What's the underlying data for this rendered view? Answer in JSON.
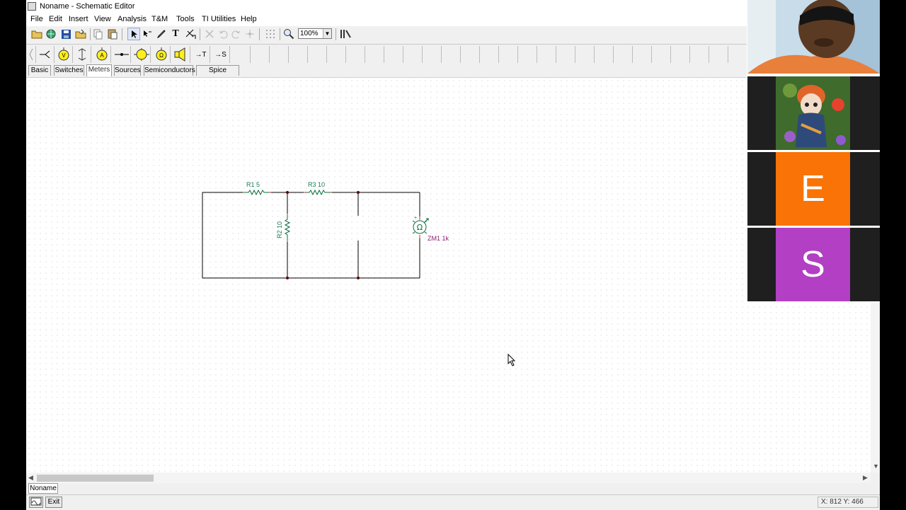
{
  "window": {
    "title": "Noname - Schematic Editor"
  },
  "menu": [
    "File",
    "Edit",
    "Insert",
    "View",
    "Analysis",
    "T&M",
    "Tools",
    "TI Utilities",
    "Help"
  ],
  "toolbar": {
    "zoom_value": "100%"
  },
  "part_tabs": [
    "Basic",
    "Switches",
    "Meters",
    "Sources",
    "Semiconductors",
    "Spice Macros"
  ],
  "active_part_tab": "Meters",
  "schematic": {
    "components": [
      {
        "id": "R1",
        "label": "R1 5"
      },
      {
        "id": "R3",
        "label": "R3 10"
      },
      {
        "id": "R2",
        "label": "R2 10"
      },
      {
        "id": "ZM1",
        "label": "ZM1 1k",
        "symbol": "Ω"
      }
    ]
  },
  "document_tab": "Noname",
  "status": {
    "exit_label": "Exit",
    "coords": "X: 812 Y: 466"
  },
  "participants": [
    {
      "type": "camera"
    },
    {
      "type": "avatar-image"
    },
    {
      "type": "initial",
      "letter": "E",
      "color": "#f97306"
    },
    {
      "type": "initial",
      "letter": "S",
      "color": "#b23fc4"
    }
  ]
}
